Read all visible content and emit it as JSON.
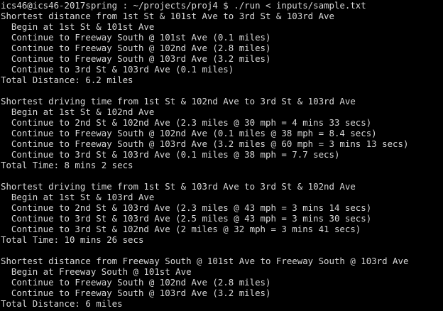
{
  "terminal": {
    "prompt_line": "ics46@ics46-2017spring : ~/projects/proj4 $ ./run < inputs/sample.txt",
    "lines": [
      "Shortest distance from 1st St & 101st Ave to 3rd St & 103rd Ave",
      "  Begin at 1st St & 101st Ave",
      "  Continue to Freeway South @ 101st Ave (0.1 miles)",
      "  Continue to Freeway South @ 102nd Ave (2.8 miles)",
      "  Continue to Freeway South @ 103rd Ave (3.2 miles)",
      "  Continue to 3rd St & 103rd Ave (0.1 miles)",
      "Total Distance: 6.2 miles",
      "",
      "Shortest driving time from 1st St & 102nd Ave to 3rd St & 103rd Ave",
      "  Begin at 1st St & 102nd Ave",
      "  Continue to 2nd St & 102nd Ave (2.3 miles @ 30 mph = 4 mins 33 secs)",
      "  Continue to Freeway South @ 102nd Ave (0.1 miles @ 38 mph = 8.4 secs)",
      "  Continue to Freeway South @ 103rd Ave (3.2 miles @ 60 mph = 3 mins 13 secs)",
      "  Continue to 3rd St & 103rd Ave (0.1 miles @ 38 mph = 7.7 secs)",
      "Total Time: 8 mins 2 secs",
      "",
      "Shortest driving time from 1st St & 103rd Ave to 3rd St & 102nd Ave",
      "  Begin at 1st St & 103rd Ave",
      "  Continue to 2nd St & 103rd Ave (2.3 miles @ 43 mph = 3 mins 14 secs)",
      "  Continue to 3rd St & 103rd Ave (2.5 miles @ 43 mph = 3 mins 30 secs)",
      "  Continue to 3rd St & 102nd Ave (2 miles @ 32 mph = 3 mins 41 secs)",
      "Total Time: 10 mins 26 secs",
      "",
      "Shortest distance from Freeway South @ 101st Ave to Freeway South @ 103rd Ave",
      "  Begin at Freeway South @ 101st Ave",
      "  Continue to Freeway South @ 102nd Ave (2.8 miles)",
      "  Continue to Freeway South @ 103rd Ave (3.2 miles)",
      "Total Distance: 6 miles"
    ],
    "colors": {
      "background": "#000000",
      "foreground": "#d8d8d8"
    }
  }
}
